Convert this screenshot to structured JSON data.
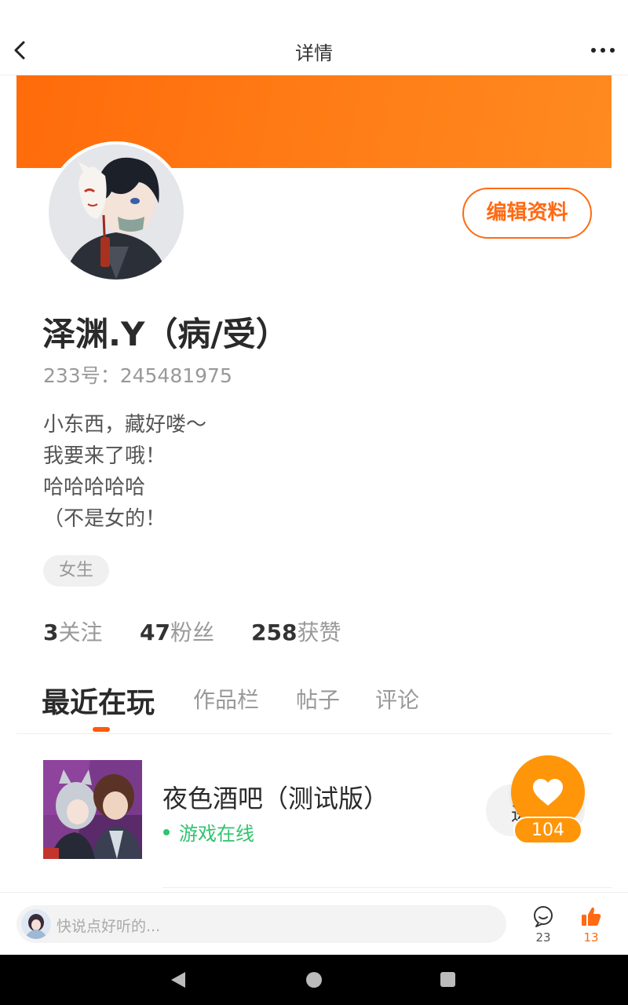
{
  "header": {
    "title": "详情"
  },
  "profile": {
    "edit_label": "编辑资料",
    "username": "泽渊.Y（病/受）",
    "id_text": "233号：245481975",
    "bio": [
      "小东西，藏好喽～",
      "我要来了哦！",
      "哈哈哈哈哈",
      "（不是女的！"
    ],
    "gender": "女生"
  },
  "stats": [
    {
      "num": "3",
      "label": "关注"
    },
    {
      "num": "47",
      "label": "粉丝"
    },
    {
      "num": "258",
      "label": "获赞"
    }
  ],
  "tabs": [
    {
      "label": "最近在玩",
      "active": true
    },
    {
      "label": "作品栏",
      "active": false
    },
    {
      "label": "帖子",
      "active": false
    },
    {
      "label": "评论",
      "active": false
    }
  ],
  "game": {
    "title": "夜色酒吧（测试版）",
    "status": "游戏在线",
    "button_partial": "进"
  },
  "like_fab": {
    "count": "104"
  },
  "comment_bar": {
    "placeholder": "快说点好听的...",
    "comment_count": "23",
    "like_count": "13"
  },
  "colors": {
    "accent": "#ff6a13",
    "banner": "#ff7a14",
    "online": "#2fc46d",
    "fab": "#ff9509"
  }
}
